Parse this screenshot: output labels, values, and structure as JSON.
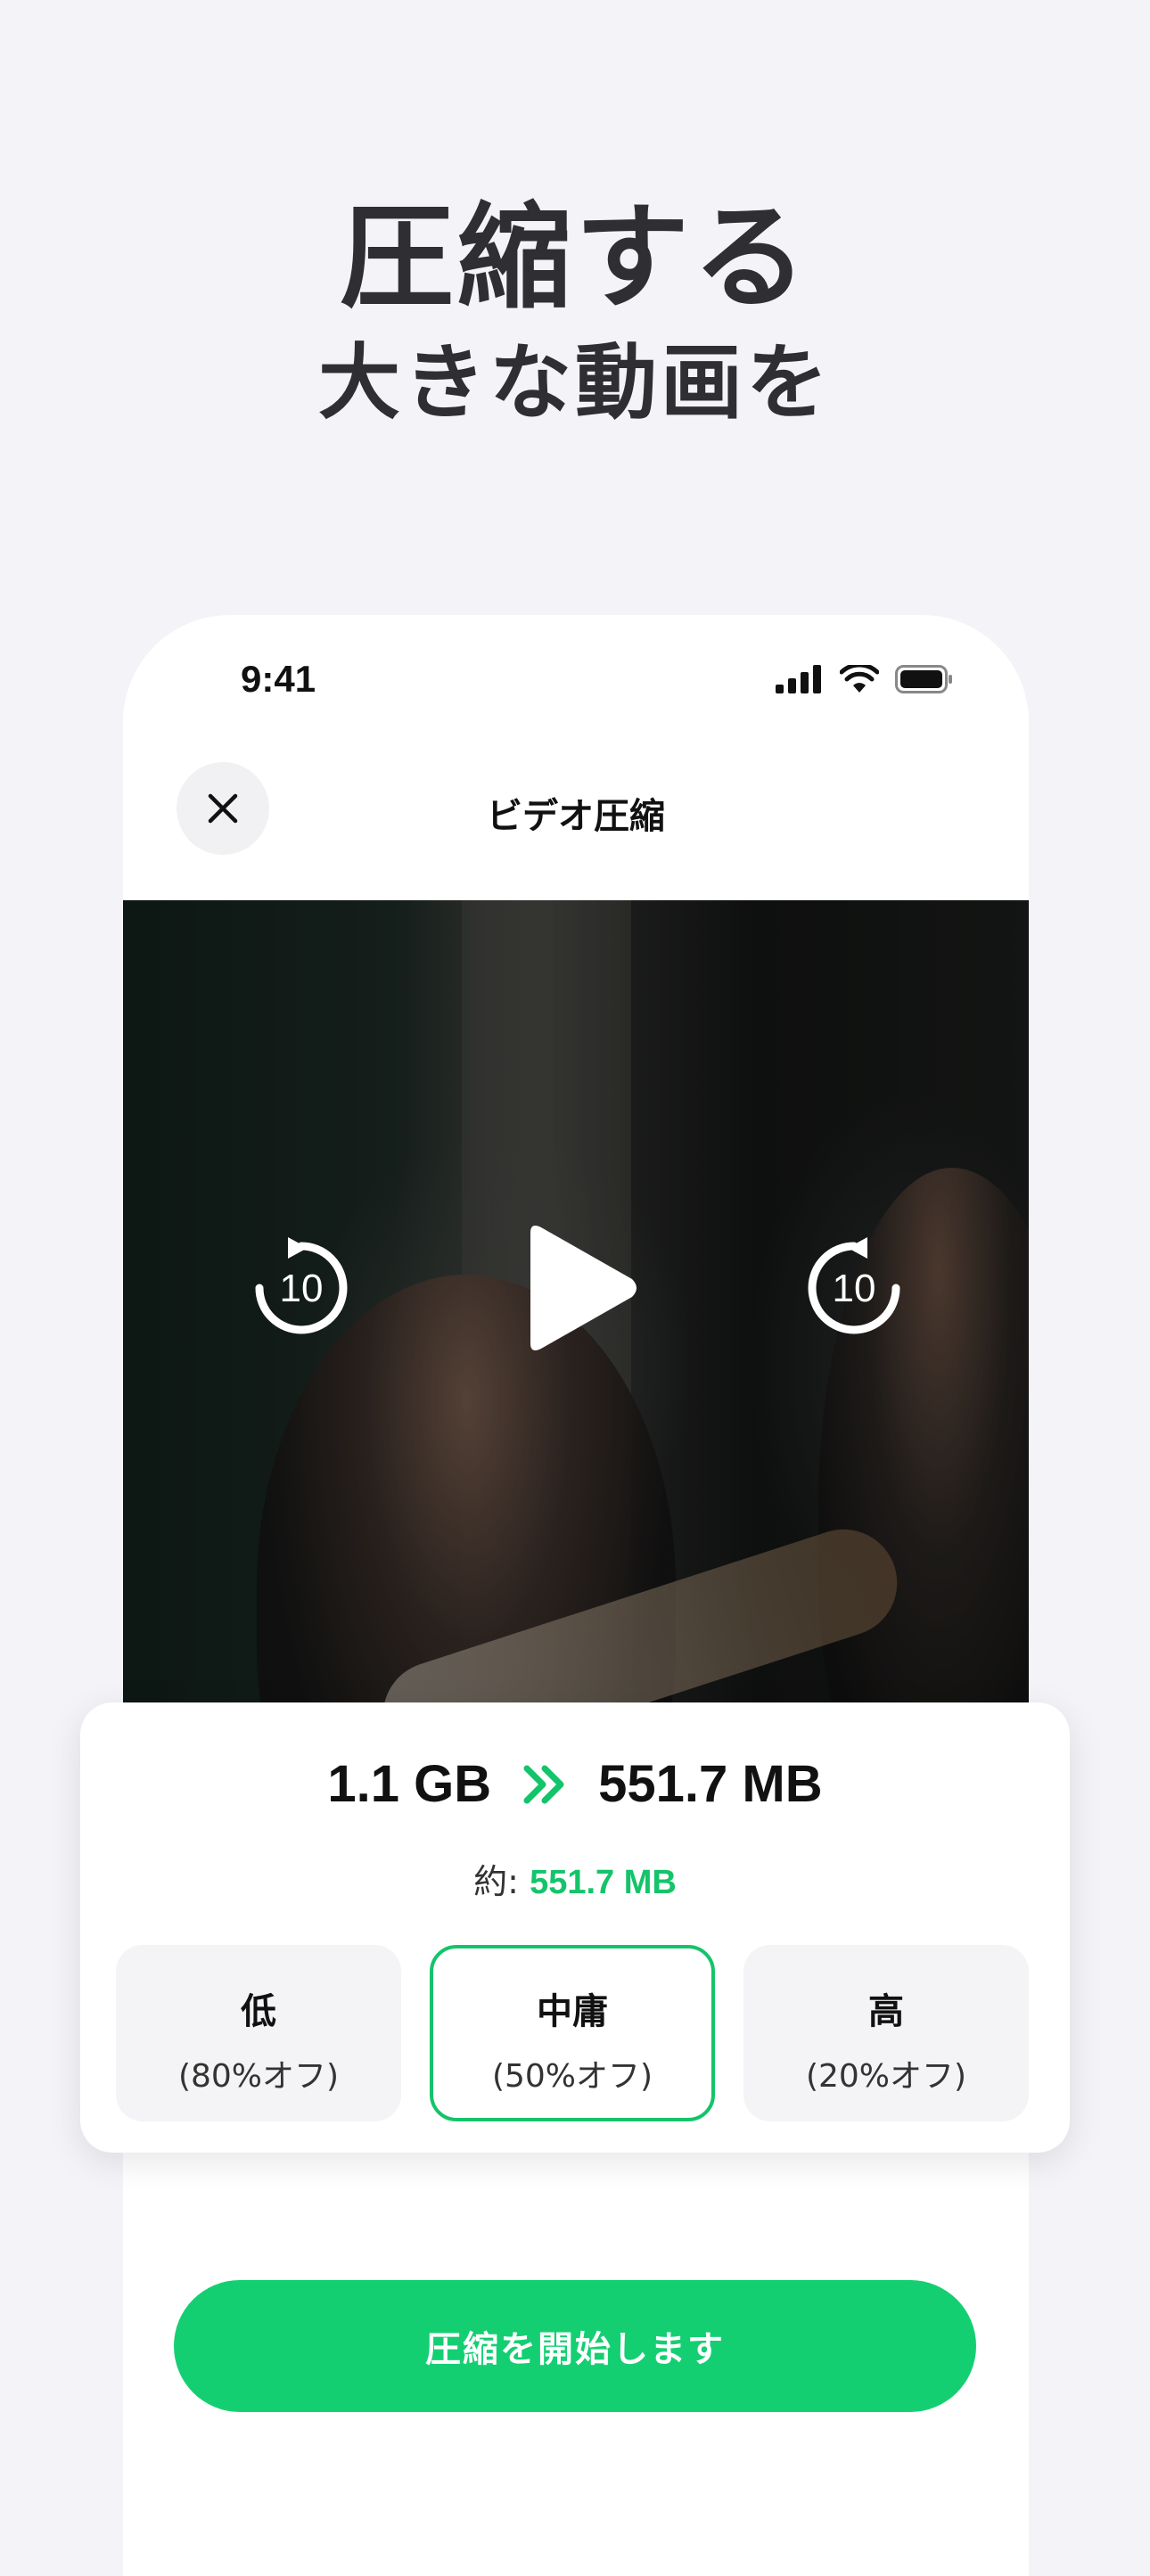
{
  "headline": {
    "line1": "圧縮する",
    "line2": "大きな動画を"
  },
  "status_bar": {
    "time": "9:41",
    "icons": [
      "cellular-signal-icon",
      "wifi-icon",
      "battery-icon"
    ]
  },
  "nav": {
    "title": "ビデオ圧縮",
    "close_icon": "close-icon"
  },
  "player": {
    "rewind_seconds": "10",
    "forward_seconds": "10",
    "icons": [
      "rewind-10-icon",
      "play-icon",
      "forward-10-icon"
    ]
  },
  "compression": {
    "original_size": "1.1 GB",
    "arrow_icon": "double-chevron-right-icon",
    "result_size": "551.7 MB",
    "approx_label": "約:",
    "approx_value": "551.7 MB",
    "options": [
      {
        "label": "低",
        "sub": "(80%オフ)",
        "selected": false
      },
      {
        "label": "中庸",
        "sub": "(50%オフ)",
        "selected": true
      },
      {
        "label": "高",
        "sub": "(20%オフ)",
        "selected": false
      }
    ]
  },
  "start_button": {
    "label": "圧縮を開始します"
  },
  "colors": {
    "accent": "#14cf72",
    "accent_text": "#14c46a",
    "background": "#f4f4f8",
    "headline": "#2e2e33"
  }
}
